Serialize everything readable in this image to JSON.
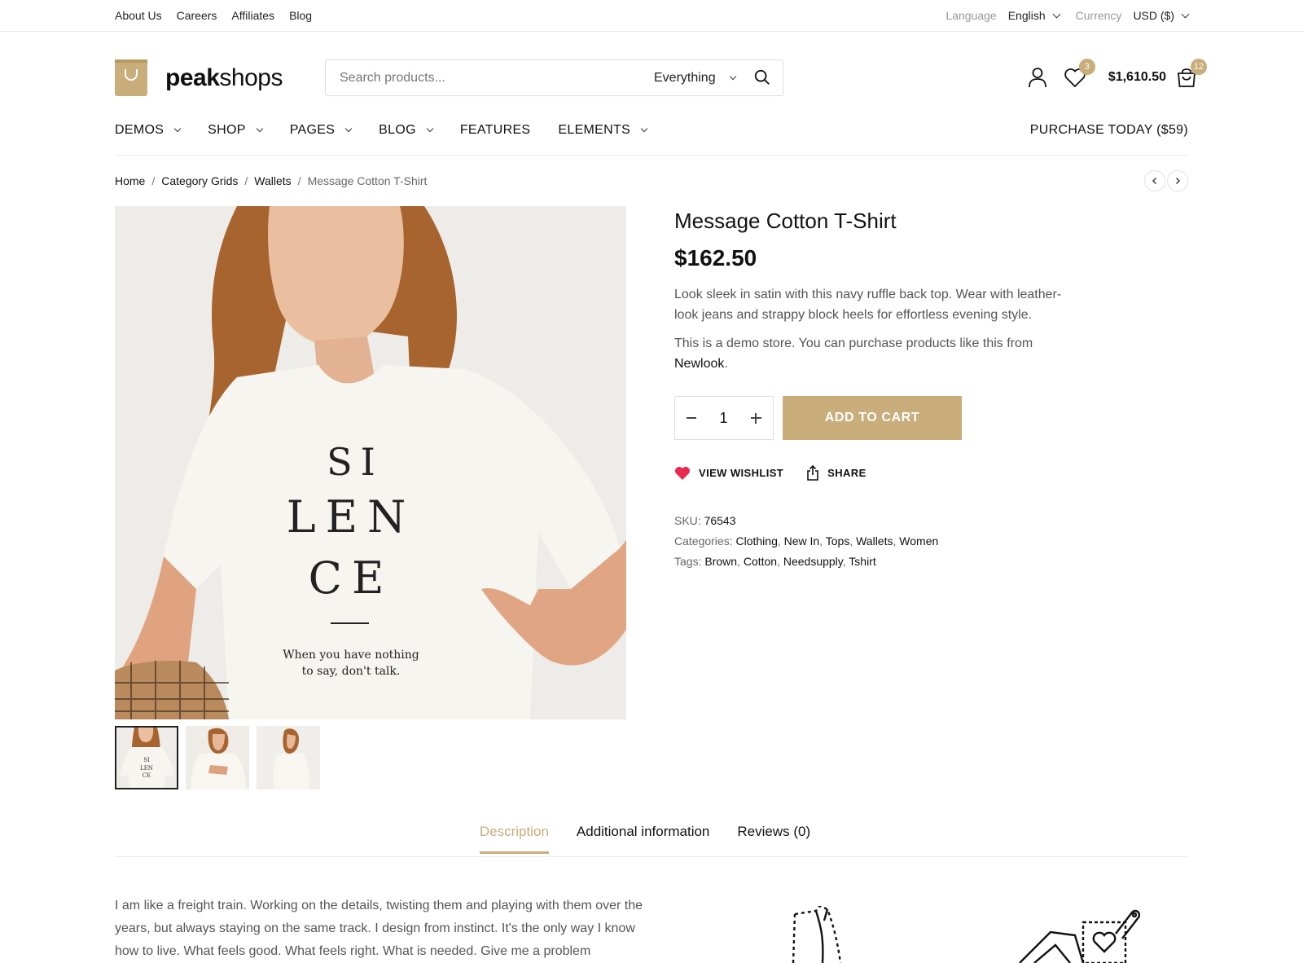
{
  "topbar": {
    "links": [
      "About Us",
      "Careers",
      "Affiliates",
      "Blog"
    ],
    "language_label": "Language",
    "language_value": "English",
    "currency_label": "Currency",
    "currency_value": "USD ($)"
  },
  "header": {
    "logo_text_bold": "peak",
    "logo_text_light": "shops",
    "search_placeholder": "Search products...",
    "search_category": "Everything",
    "wishlist_count": "3",
    "cart_total": "$1,610.50",
    "cart_count": "12"
  },
  "nav": {
    "items": [
      {
        "label": "DEMOS",
        "dropdown": true
      },
      {
        "label": "SHOP",
        "dropdown": true
      },
      {
        "label": "PAGES",
        "dropdown": true
      },
      {
        "label": "BLOG",
        "dropdown": true
      },
      {
        "label": "FEATURES",
        "dropdown": false
      },
      {
        "label": "ELEMENTS",
        "dropdown": true
      }
    ],
    "purchase_label": "PURCHASE TODAY ($59)"
  },
  "breadcrumb": [
    "Home",
    "Category Grids",
    "Wallets",
    "Message Cotton T-Shirt"
  ],
  "product": {
    "title": "Message Cotton T-Shirt",
    "price": "$162.50",
    "description": "Look sleek in satin with this navy ruffle back top. Wear with leather-look jeans and strappy block heels for effortless evening style.",
    "demo_note": "This is a demo store. You can purchase products like this from",
    "demo_link": "Newlook",
    "demo_end": ".",
    "quantity": "1",
    "add_to_cart": "ADD TO CART",
    "wishlist_label": "VIEW WISHLIST",
    "share_label": "SHARE",
    "sku_label": "SKU:",
    "sku": "76543",
    "categories_label": "Categories:",
    "categories": [
      "Clothing",
      "New In",
      "Tops",
      "Wallets",
      "Women"
    ],
    "tags_label": "Tags:",
    "tags": [
      "Brown",
      "Cotton",
      "Needsupply",
      "Tshirt"
    ],
    "shirt_print": [
      "SI",
      "LEN",
      "CE"
    ],
    "shirt_caption_1": "When you have nothing",
    "shirt_caption_2": "to say, don't talk."
  },
  "tabs": [
    "Description",
    "Additional information",
    "Reviews (0)"
  ],
  "long_description": "I am like a freight train. Working on the details, twisting them and playing with them over the years, but always staying on the same track. I design from instinct. It's the only way I know how to live. What feels good. What feels right. What is needed. Give me a problem",
  "colors": {
    "accent": "#c9ad7a",
    "heart": "#e8284e"
  }
}
